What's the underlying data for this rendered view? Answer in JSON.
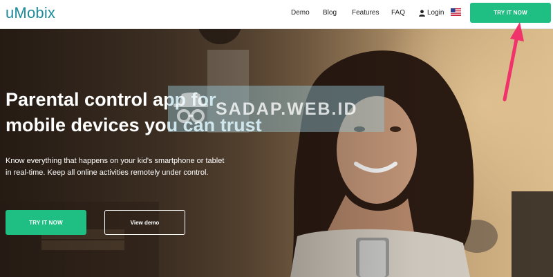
{
  "header": {
    "logo": "uMobix",
    "nav": {
      "demo": "Demo",
      "blog": "Blog",
      "features": "Features",
      "faq": "FAQ",
      "login": "Login"
    },
    "cta": "TRY IT NOW"
  },
  "hero": {
    "headline_line1": "Parental control app for",
    "headline_line2": "mobile devices you can trust",
    "subtext_line1": "Know everything that happens on your kid's smartphone or tablet",
    "subtext_line2": "in real-time. Keep all online activities remotely under control.",
    "primary_cta": "TRY IT NOW",
    "secondary_cta": "View demo"
  },
  "watermark": {
    "text": "SADAP.WEB.ID"
  },
  "icons": {
    "user": "user-icon",
    "flag": "us-flag-icon",
    "watermark": "spy-hat-icon",
    "arrow": "annotation-arrow-icon"
  },
  "colors": {
    "brand": "#1b8a9a",
    "cta": "#1fbf83",
    "annotation": "#f0336b"
  }
}
